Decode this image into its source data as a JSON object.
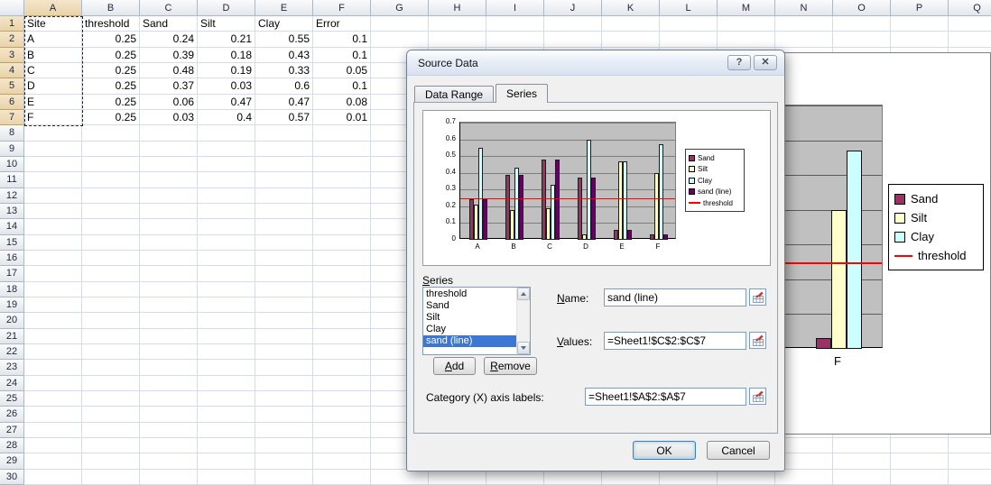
{
  "spreadsheet": {
    "columns": [
      "A",
      "B",
      "C",
      "D",
      "E",
      "F",
      "G",
      "H",
      "I",
      "J",
      "K",
      "L",
      "M",
      "N",
      "O",
      "P",
      "Q"
    ],
    "rows": 30,
    "selection": {
      "range": "A1:A7",
      "columns": [
        "A"
      ],
      "row_start": 1,
      "row_end": 7
    },
    "cells": [
      {
        "ref": "A1",
        "v": "Site"
      },
      {
        "ref": "B1",
        "v": "threshold"
      },
      {
        "ref": "C1",
        "v": "Sand"
      },
      {
        "ref": "D1",
        "v": "Silt"
      },
      {
        "ref": "E1",
        "v": "Clay"
      },
      {
        "ref": "F1",
        "v": "Error"
      },
      {
        "ref": "A2",
        "v": "A"
      },
      {
        "ref": "B2",
        "v": 0.25
      },
      {
        "ref": "C2",
        "v": 0.24
      },
      {
        "ref": "D2",
        "v": 0.21
      },
      {
        "ref": "E2",
        "v": 0.55
      },
      {
        "ref": "F2",
        "v": 0.1
      },
      {
        "ref": "A3",
        "v": "B"
      },
      {
        "ref": "B3",
        "v": 0.25
      },
      {
        "ref": "C3",
        "v": 0.39
      },
      {
        "ref": "D3",
        "v": 0.18
      },
      {
        "ref": "E3",
        "v": 0.43
      },
      {
        "ref": "F3",
        "v": 0.1
      },
      {
        "ref": "A4",
        "v": "C"
      },
      {
        "ref": "B4",
        "v": 0.25
      },
      {
        "ref": "C4",
        "v": 0.48
      },
      {
        "ref": "D4",
        "v": 0.19
      },
      {
        "ref": "E4",
        "v": 0.33
      },
      {
        "ref": "F4",
        "v": 0.05
      },
      {
        "ref": "A5",
        "v": "D"
      },
      {
        "ref": "B5",
        "v": 0.25
      },
      {
        "ref": "C5",
        "v": 0.37
      },
      {
        "ref": "D5",
        "v": 0.03
      },
      {
        "ref": "E5",
        "v": 0.6
      },
      {
        "ref": "F5",
        "v": 0.1
      },
      {
        "ref": "A6",
        "v": "E"
      },
      {
        "ref": "B6",
        "v": 0.25
      },
      {
        "ref": "C6",
        "v": 0.06
      },
      {
        "ref": "D6",
        "v": 0.47
      },
      {
        "ref": "E6",
        "v": 0.47
      },
      {
        "ref": "F6",
        "v": 0.08
      },
      {
        "ref": "A7",
        "v": "F"
      },
      {
        "ref": "B7",
        "v": 0.25
      },
      {
        "ref": "C7",
        "v": 0.03
      },
      {
        "ref": "D7",
        "v": 0.4
      },
      {
        "ref": "E7",
        "v": 0.57
      },
      {
        "ref": "F7",
        "v": 0.01
      }
    ]
  },
  "chart_data": {
    "type": "bar",
    "title": "",
    "categories": [
      "A",
      "B",
      "C",
      "D",
      "E",
      "F"
    ],
    "series": [
      {
        "name": "Sand",
        "type": "bar",
        "color": "#993366",
        "values": [
          0.24,
          0.39,
          0.48,
          0.37,
          0.06,
          0.03
        ]
      },
      {
        "name": "Silt",
        "type": "bar",
        "color": "#ffffcc",
        "values": [
          0.21,
          0.18,
          0.19,
          0.03,
          0.47,
          0.4
        ]
      },
      {
        "name": "Clay",
        "type": "bar",
        "color": "#ccffff",
        "values": [
          0.55,
          0.43,
          0.33,
          0.6,
          0.47,
          0.57
        ]
      },
      {
        "name": "sand (line)",
        "type": "bar",
        "color": "#660066",
        "values": [
          0.24,
          0.39,
          0.48,
          0.37,
          0.06,
          0.03
        ]
      },
      {
        "name": "threshold",
        "type": "line",
        "color": "#ff0000",
        "values": [
          0.25,
          0.25,
          0.25,
          0.25,
          0.25,
          0.25
        ]
      }
    ],
    "ylim": [
      0,
      0.7
    ],
    "yticks": [
      0,
      0.1,
      0.2,
      0.3,
      0.4,
      0.5,
      0.6,
      0.7
    ],
    "legend_position": "right",
    "plot_background": "#c0c0c0"
  },
  "worksheet_chart": {
    "ylim": [
      0,
      0.7
    ],
    "gridline_step": 0.1,
    "category_label": "F",
    "bars": [
      {
        "name": "Sand",
        "color": "#993366",
        "value": 0.03
      },
      {
        "name": "Silt",
        "color": "#ffffcc",
        "value": 0.4
      },
      {
        "name": "Clay",
        "color": "#ccffff",
        "value": 0.57
      }
    ],
    "threshold": {
      "name": "threshold",
      "color": "#ff0000",
      "value": 0.25
    }
  },
  "dialog": {
    "title": "Source Data",
    "titlebar": {
      "help_glyph": "?",
      "close_glyph": "✕"
    },
    "tabs": [
      {
        "label": "Data Range",
        "active": false
      },
      {
        "label": "Series",
        "active": true
      }
    ],
    "series_group": {
      "label": "Series",
      "items": [
        "threshold",
        "Sand",
        "Silt",
        "Clay",
        "sand (line)"
      ],
      "selected": "sand (line)",
      "add_label": "Add",
      "remove_label": "Remove"
    },
    "fields": {
      "name_label": "Name:",
      "name_value": "sand (line)",
      "values_label": "Values:",
      "values_value": "=Sheet1!$C$2:$C$7",
      "category_label": "Category (X) axis labels:",
      "category_value": "=Sheet1!$A$2:$A$7"
    },
    "buttons": {
      "ok": "OK",
      "cancel": "Cancel"
    }
  }
}
